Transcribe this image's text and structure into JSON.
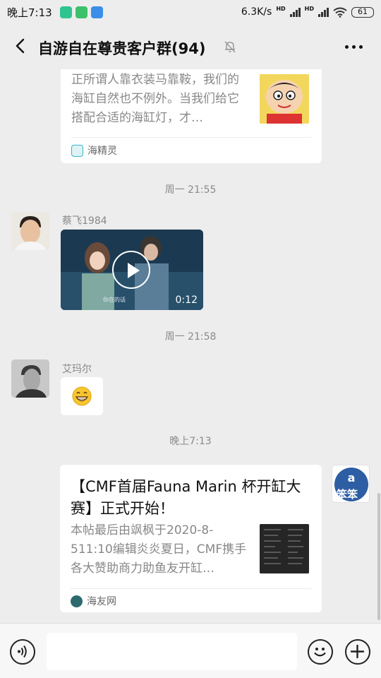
{
  "status_bar": {
    "time": "晚上7:13",
    "network_speed": "6.3K/s",
    "hd_label": "HD",
    "battery": "61"
  },
  "header": {
    "title": "自游自在尊贵客户群(94)"
  },
  "messages": {
    "card1": {
      "desc": "正所谓人靠衣装马靠鞍，我们的海缸自然也不例外。当我们给它搭配合适的海缸灯，才…",
      "source": "海精灵"
    },
    "ts1": "周一 21:55",
    "video_msg": {
      "sender": "蔡飞1984",
      "subtitle": "你在的话",
      "duration": "0:12"
    },
    "ts2": "周一 21:58",
    "emoji_msg": {
      "sender": "艾玛尔",
      "emoji": "😁"
    },
    "ts3": "晚上7:13",
    "card2": {
      "title": "【CMF首届Fauna Marin 杯开缸大赛】正式开始！",
      "desc": "本帖最后由飒枫于2020-8-511:10编辑炎炎夏日，CMF携手各大赞助商力助鱼友开缸…",
      "source": "海友网",
      "avatar_text": "笨笨"
    }
  },
  "colors": {
    "background": "#ededed",
    "bubble": "#ffffff",
    "muted_text": "#888888"
  }
}
